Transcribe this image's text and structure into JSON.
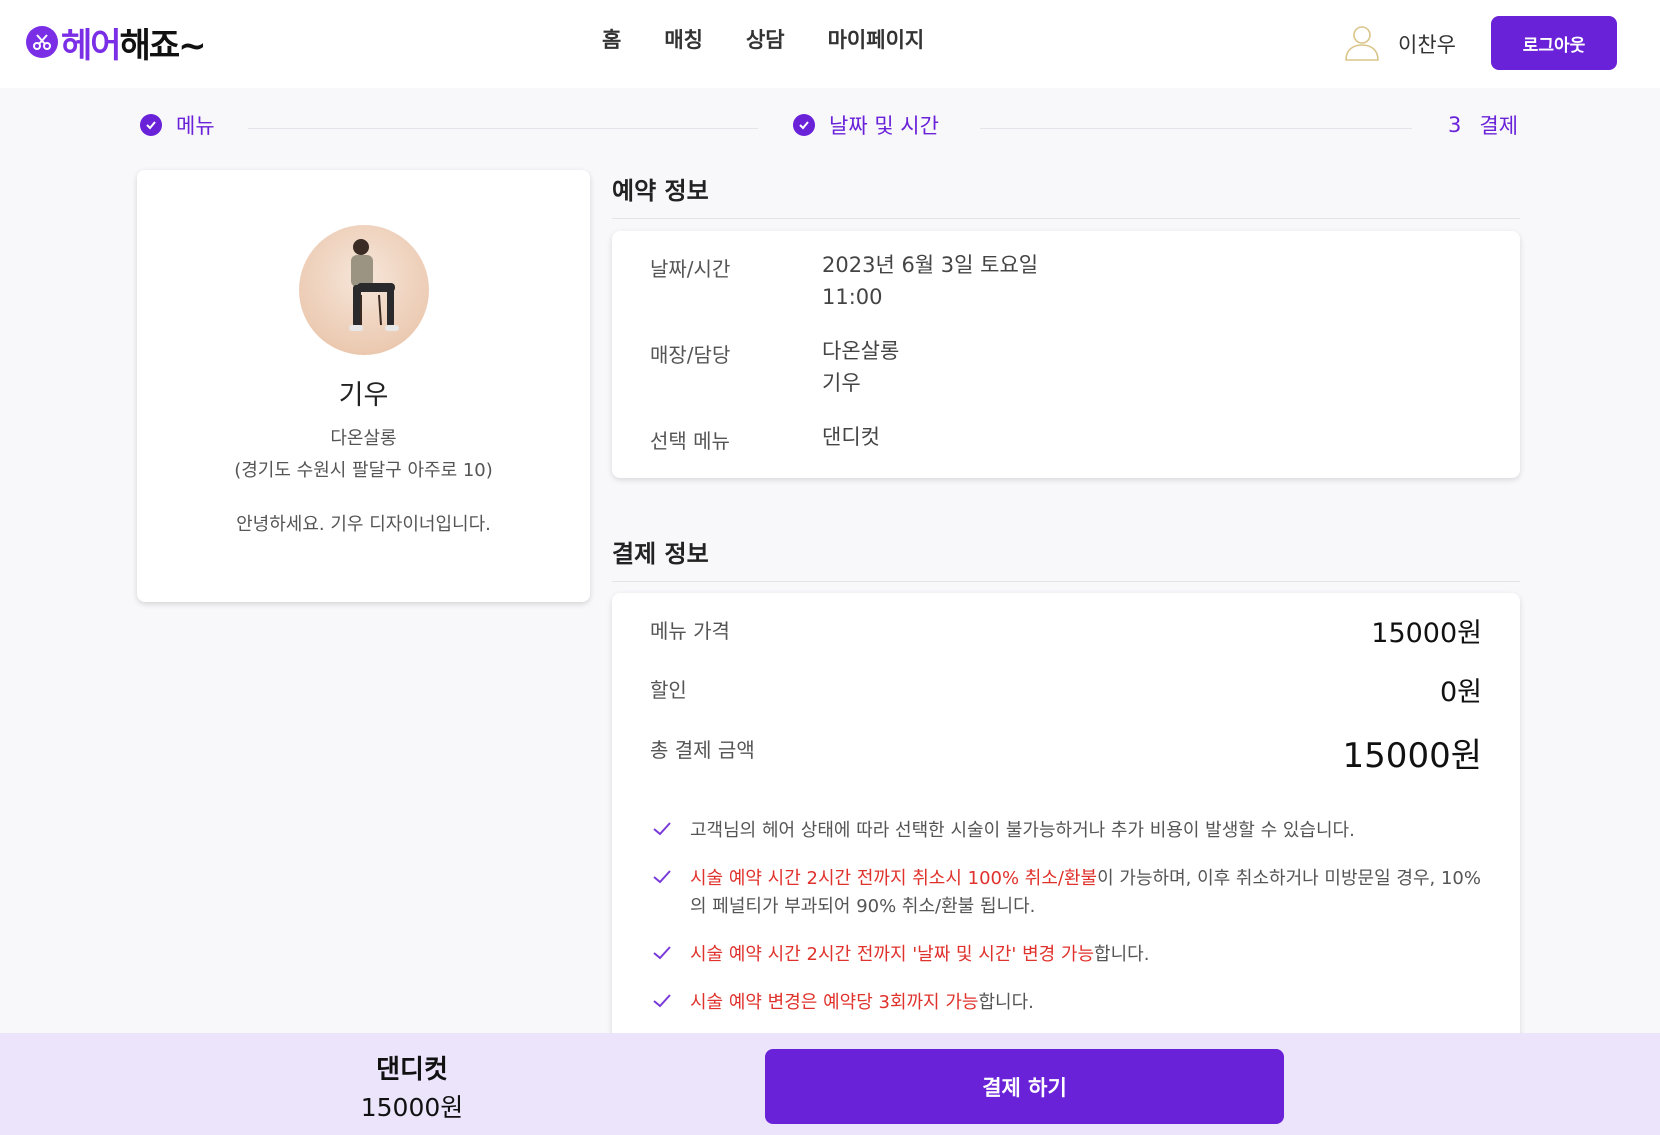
{
  "header": {
    "logo_text_1": "헤어",
    "logo_text_2": "해죠~",
    "nav": [
      "홈",
      "매칭",
      "상담",
      "마이페이지"
    ],
    "user_name": "이찬우",
    "logout_label": "로그아웃",
    "accent_color": "#6a22d9",
    "user_icon": "user-outline-icon"
  },
  "steps": {
    "step1": "메뉴",
    "step2": "날짜 및 시간",
    "step3_number": "3",
    "step3": "결제"
  },
  "designer": {
    "name": "기우",
    "shop": "다온살롱",
    "address": "(경기도 수원시 팔달구 아주로 10)",
    "intro": "안녕하세요. 기우 디자이너입니다."
  },
  "reservation": {
    "title": "예약 정보",
    "date_label": "날짜/시간",
    "date_value": "2023년 6월 3일 토요일",
    "time_value": "11:00",
    "shop_label": "매장/담당",
    "shop_value": "다온살롱",
    "staff_value": "기우",
    "menu_label": "선택 메뉴",
    "menu_value": "댄디컷"
  },
  "payment": {
    "title": "결제 정보",
    "price_label": "메뉴 가격",
    "price_value": "15000원",
    "discount_label": "할인",
    "discount_value": "0원",
    "total_label": "총 결제 금액",
    "total_value": "15000원",
    "notices": [
      {
        "red": "",
        "rest": "고객님의 헤어 상태에 따라 선택한 시술이 불가능하거나 추가 비용이 발생할 수 있습니다."
      },
      {
        "red": "시술 예약 시간 2시간 전까지 취소시 100% 취소/환불",
        "rest": "이 가능하며, 이후 취소하거나 미방문일 경우, 10%의 페널티가 부과되어 90% 취소/환불 됩니다."
      },
      {
        "red": "시술 예약 시간 2시간 전까지 '날짜 및 시간' 변경 가능",
        "rest": "합니다."
      },
      {
        "red": "시술 예약 변경은 예약당 3회까지 가능",
        "rest": "합니다."
      }
    ]
  },
  "bottom": {
    "menu": "댄디컷",
    "price": "15000원",
    "pay_label": "결제 하기"
  }
}
